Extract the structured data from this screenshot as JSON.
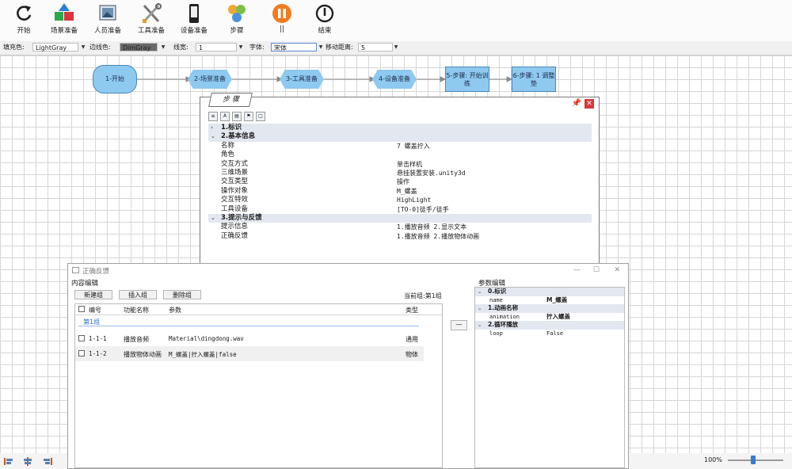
{
  "toolbar": {
    "items": [
      {
        "label": "开始",
        "icon": "refresh-icon"
      },
      {
        "label": "场景准备",
        "icon": "scene-cubes-icon"
      },
      {
        "label": "人员准备",
        "icon": "person-picture-icon"
      },
      {
        "label": "工具准备",
        "icon": "tools-icon"
      },
      {
        "label": "设备准备",
        "icon": "device-icon"
      },
      {
        "label": "步骤",
        "icon": "steps-icon"
      },
      {
        "label": "||",
        "icon": "pause-icon"
      },
      {
        "label": "结束",
        "icon": "stop-icon"
      }
    ]
  },
  "format_bar": {
    "fill_label": "填充色:",
    "fill_value": "LightGray",
    "border_label": "边线色:",
    "border_value": "DimGray",
    "width_label": "线宽:",
    "width_value": "1",
    "font_label": "字体:",
    "font_value": "宋体",
    "move_label": "移动距离:",
    "move_value": "5"
  },
  "flow": {
    "nodes": [
      "1-开始",
      "2-场景准备",
      "3-工具准备",
      "4-设备准备",
      "5-步骤: 开始训练",
      "6-步骤: 1 调整垫"
    ]
  },
  "properties_panel": {
    "title": "步 骤",
    "categories": [
      {
        "name": "1.标识",
        "expanded": false,
        "rows": []
      },
      {
        "name": "2.基本信息",
        "expanded": true,
        "rows": [
          {
            "key": "名称",
            "value": "7 螺盖拧入"
          },
          {
            "key": "角色",
            "value": ""
          },
          {
            "key": "交互方式",
            "value": "单击样机"
          },
          {
            "key": "三维场景",
            "value": "悬挂装置安装.unity3d"
          },
          {
            "key": "交互类型",
            "value": "操作"
          },
          {
            "key": "操作对象",
            "value": "M_螺盖"
          },
          {
            "key": "交互特效",
            "value": "HighLight"
          },
          {
            "key": "工具设备",
            "value": "[TO-0]徒手/徒手"
          }
        ]
      },
      {
        "name": "3.提示与反馈",
        "expanded": true,
        "rows": [
          {
            "key": "提示信息",
            "value": "1.播放音频  2.显示文本"
          },
          {
            "key": "正确反馈",
            "value": "1.播放音频  2.播放物体动画"
          }
        ]
      }
    ]
  },
  "dialog": {
    "title": "正确反馈",
    "content_group": "内容编辑",
    "param_group": "参数编辑",
    "buttons": {
      "new": "新建组",
      "insert": "插入组",
      "delete": "删除组",
      "remove": "—"
    },
    "current_group": "当前组:第1组",
    "table": {
      "headers": [
        "编号",
        "功能名称",
        "参数",
        "类型"
      ],
      "group_name": "第1组",
      "rows": [
        {
          "id": "1-1-1",
          "func": "播放音频",
          "param": "Material\\dingdong.wav",
          "type": "通用"
        },
        {
          "id": "1-1-2",
          "func": "播放物体动画",
          "param": "M_螺盖|拧入螺盖|false",
          "type": "物体"
        }
      ]
    },
    "params": [
      {
        "category": "0.标识",
        "rows": [
          {
            "key": "name",
            "value": "M_螺盖"
          }
        ]
      },
      {
        "category": "1.动画名称",
        "rows": [
          {
            "key": "animation",
            "value": "拧入螺盖"
          }
        ]
      },
      {
        "category": "2.循环播放",
        "rows": [
          {
            "key": "loop",
            "value": "False"
          }
        ]
      }
    ]
  },
  "status": {
    "zoom": "100%",
    "zoom_level": 0.45
  }
}
